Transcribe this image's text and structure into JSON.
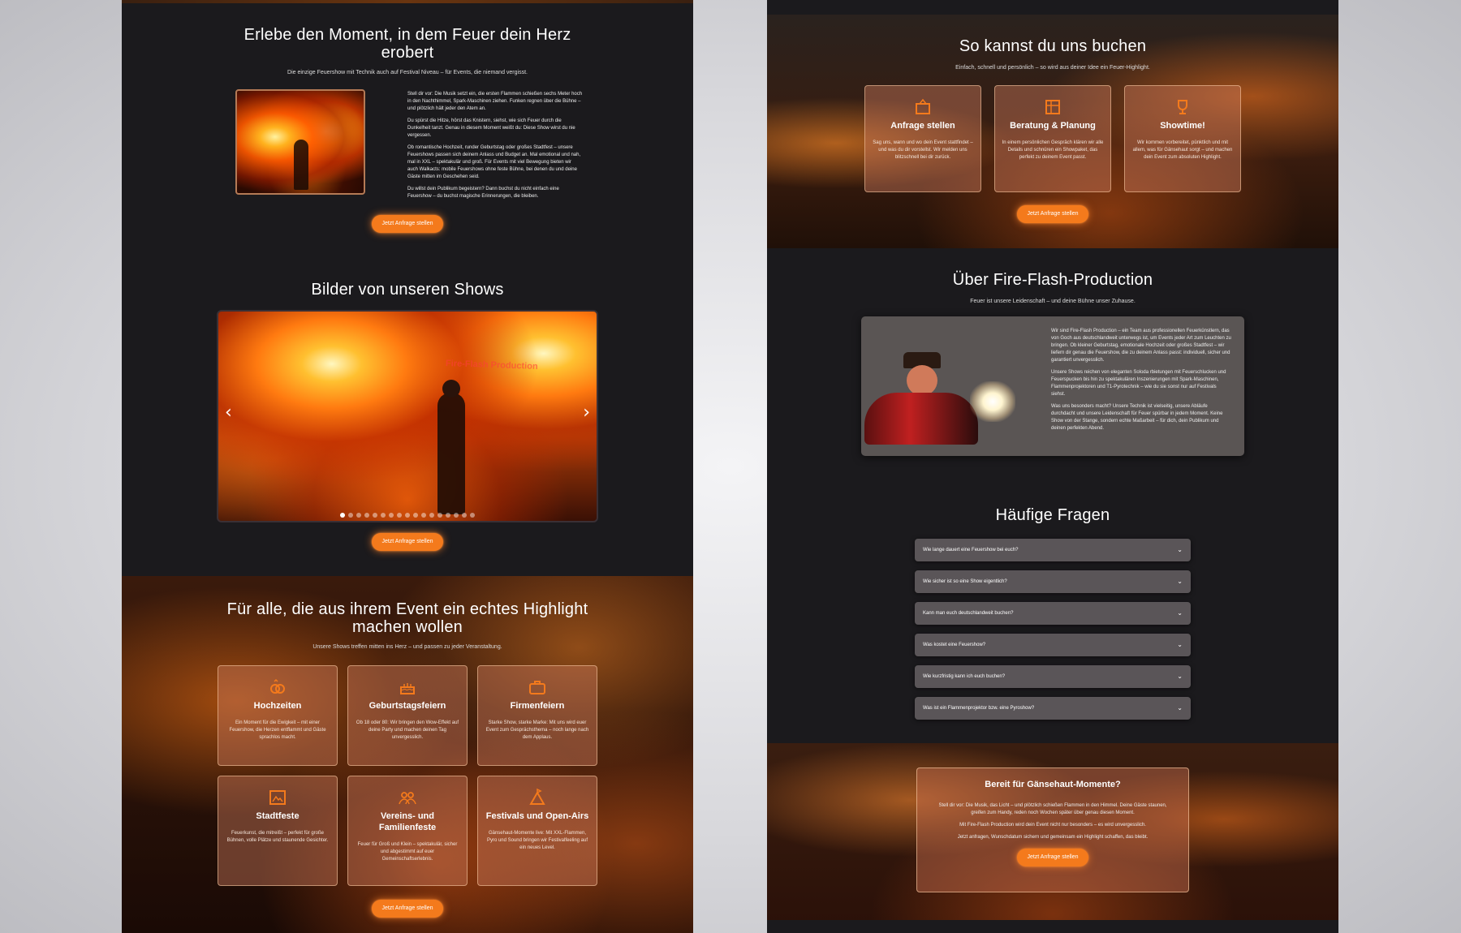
{
  "left": {
    "hero": {
      "title": "Erlebe den Moment, in dem Feuer dein Herz erobert",
      "subtitle": "Die einzige Feuershow mit Technik auch auf Festival Niveau – für Events, die niemand vergisst.",
      "paragraphs": [
        "Stell dir vor: Die Musik setzt ein, die ersten Flammen schießen sechs Meter hoch in den Nachthimmel, Spark-Maschinen ziehen. Funken regnen über die Bühne – und plötzlich hält jeder den Atem an.",
        "Du spürst die Hitze, hörst das Knistern, siehst, wie sich Feuer durch die Dunkelheit tanzt. Genau in diesem Moment weißt du: Diese Show wirst du nie vergessen.",
        "Ob romantische Hochzeit, runder Geburtstag oder großes Stadtfest – unsere Feuershows passen sich deinem Anlass und Budget an. Mal emotional und nah, mal in XXL – spektakulär und groß. Für Events mit viel Bewegung bieten wir auch Walkacts: mobile Feuershows ohne feste Bühne, bei denen du und deine Gäste mitten im Geschehen seid.",
        "Du willst dein Publikum begeistern? Dann buchst du nicht einfach eine Feuershow – du buchst magische Erinnerungen, die bleiben."
      ],
      "button": "Jetzt Anfrage stellen"
    },
    "gallery": {
      "title": "Bilder von unseren Shows",
      "watermark": "Fire-Flash Production",
      "prev": "‹",
      "next": "›",
      "dot_count": 17,
      "active_dot": 0,
      "button": "Jetzt Anfrage stellen"
    },
    "events": {
      "title": "Für alle, die aus ihrem Event ein echtes Highlight machen wollen",
      "subtitle": "Unsere Shows treffen mitten ins Herz – und passen zu jeder Veranstaltung.",
      "cards": [
        {
          "title": "Hochzeiten",
          "desc": "Ein Moment für die Ewigkeit – mit einer Feuershow, die Herzen entflammt und Gäste sprachlos macht."
        },
        {
          "title": "Geburtstagsfeiern",
          "desc": "Ob 18 oder 80: Wir bringen den Wow-Effekt auf deine Party und machen deinen Tag unvergesslich."
        },
        {
          "title": "Firmenfeiern",
          "desc": "Starke Show, starke Marke: Mit uns wird euer Event zum Gesprächsthema – noch lange nach dem Applaus."
        },
        {
          "title": "Stadtfeste",
          "desc": "Feuerkunst, die mitreißt – perfekt für große Bühnen, volle Plätze und staunende Gesichter."
        },
        {
          "title": "Vereins- und Familienfeste",
          "desc": "Feuer für Groß und Klein – spektakulär, sicher und abgestimmt auf euer Gemeinschaftserlebnis."
        },
        {
          "title": "Festivals und Open-Airs",
          "desc": "Gänsehaut-Momente live: Mit XXL-Flammen, Pyro und Sound bringen wir Festivalfeeling auf ein neues Level."
        }
      ],
      "button": "Jetzt Anfrage stellen"
    }
  },
  "right": {
    "booking": {
      "title": "So kannst du uns buchen",
      "subtitle": "Einfach, schnell und persönlich – so wird aus deiner Idee ein Feuer-Highlight.",
      "cards": [
        {
          "title": "Anfrage stellen",
          "desc": "Sag uns, wann und wo dein Event stattfindet – und was du dir vorstellst. Wir melden uns blitzschnell bei dir zurück."
        },
        {
          "title": "Beratung & Planung",
          "desc": "In einem persönlichen Gespräch klären wir alle Details und schnüren ein Showpaket, das perfekt zu deinem Event passt."
        },
        {
          "title": "Showtime!",
          "desc": "Wir kommen vorbereitet, pünktlich und mit allem, was für Gänsehaut sorgt – und machen dein Event zum absoluten Highlight."
        }
      ],
      "button": "Jetzt Anfrage stellen"
    },
    "about": {
      "title": "Über Fire-Flash-Production",
      "subtitle": "Feuer ist unsere Leidenschaft – und deine Bühne unser Zuhause.",
      "paragraphs": [
        "Wir sind Fire-Flash Production – ein Team aus professionellen Feuerkünstlern, das von Goch aus deutschlandweit unterwegs ist, um Events jeder Art zum Leuchten zu bringen. Ob kleiner Geburtstag, emotionale Hochzeit oder großes Stadtfest – wir liefern dir genau die Feuershow, die zu deinem Anlass passt: individuell, sicher und garantiert unvergesslich.",
        "Unsere Shows reichen von eleganten Soloda rbietungen mit Feuerschlucken und Feuerspucken bis hin zu spektakulären Inszenierungen mit Spark-Maschinen, Flammenprojektoren und T1-Pyrotechnik – wie du sie sonst nur auf Festivals siehst.",
        "Was uns besonders macht? Unsere Technik ist vielseitig, unsere Abläufe durchdacht und unsere Leidenschaft für Feuer spürbar in jedem Moment. Keine Show von der Stange, sondern echte Maßarbeit – für dich, dein Publikum und deinen perfekten Abend."
      ]
    },
    "faq": {
      "title": "Häufige Fragen",
      "items": [
        "Wie lange dauert eine Feuershow bei euch?",
        "Wie sicher ist so eine Show eigentlich?",
        "Kann man euch deutschlandweit buchen?",
        "Was kostet eine Feuershow?",
        "Wie kurzfristig kann ich euch buchen?",
        "Was ist ein Flammenprojektor bzw. eine Pyroshow?"
      ],
      "chevron": "⌄"
    },
    "cta": {
      "title": "Bereit für Gänsehaut-Momente?",
      "paragraphs": [
        "Stell dir vor: Die Musik, das Licht – und plötzlich schießen Flammen in den Himmel. Deine Gäste staunen, greifen zum Handy, reden noch Wochen später über genau diesen Moment.",
        "Mit Fire-Flash Production wird dein Event nicht nur besonders – es wird unvergesslich.",
        "Jetzt anfragen, Wunschdatum sichern und gemeinsam ein Highlight schaffen, das bleibt."
      ],
      "button": "Jetzt Anfrage stellen"
    }
  },
  "colors": {
    "accent": "#f47a1c",
    "panel": "#1b1a1d",
    "card_border": "#ffd2aa"
  }
}
